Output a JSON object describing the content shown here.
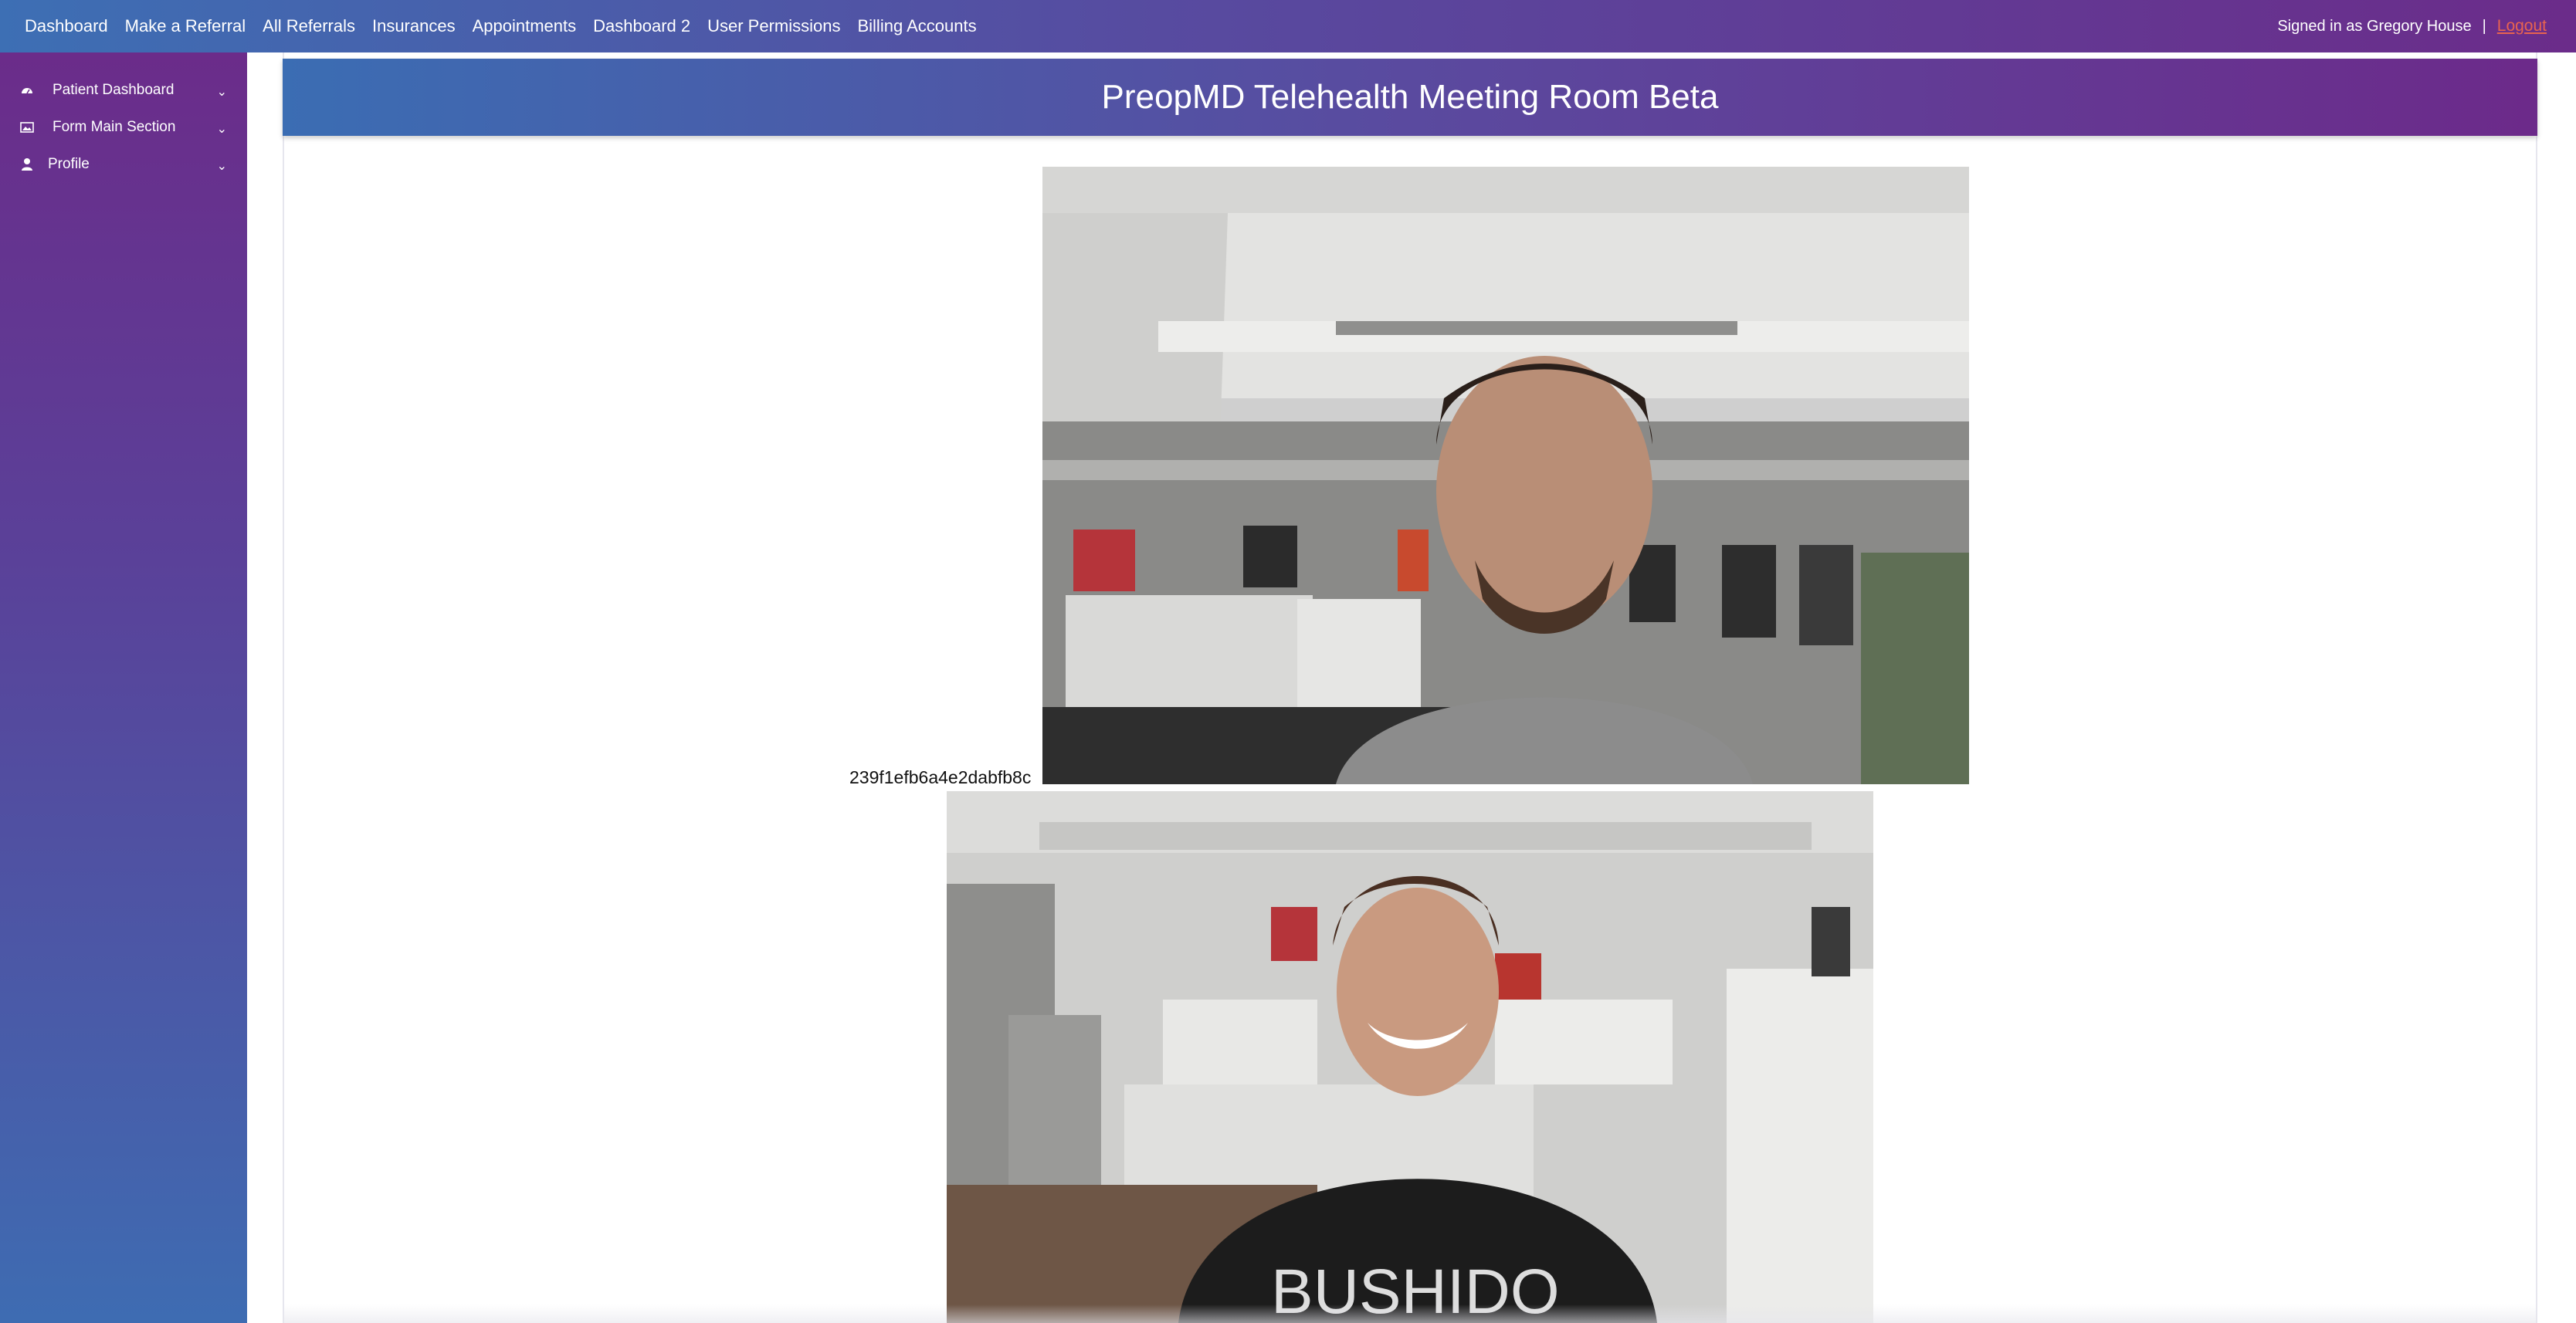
{
  "topnav": {
    "items": [
      "Dashboard",
      "Make a Referral",
      "All Referrals",
      "Insurances",
      "Appointments",
      "Dashboard 2",
      "User Permissions",
      "Billing Accounts"
    ],
    "signed_in": "Signed in as Gregory House",
    "separator": "|",
    "logout": "Logout"
  },
  "sidebar": {
    "items": [
      {
        "label": "Patient Dashboard",
        "icon": "dashboard-icon"
      },
      {
        "label": "Form Main Section",
        "icon": "image-icon"
      },
      {
        "label": "Profile",
        "icon": "user-icon"
      }
    ]
  },
  "main": {
    "title": "PreopMD Telehealth Meeting Room Beta",
    "peer_id": "239f1efb6a4e2dabfb8c"
  },
  "colors": {
    "gradient_blue": "#3d6fb4",
    "gradient_purple": "#6b2c8a",
    "logout": "#e8634f"
  }
}
